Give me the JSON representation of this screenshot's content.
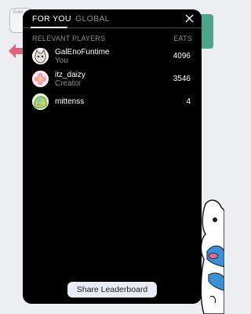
{
  "background": {
    "card_label": "Ever"
  },
  "leaderboard": {
    "tabs": [
      {
        "label": "FOR YOU",
        "active": true
      },
      {
        "label": "GLOBAL",
        "active": false
      }
    ],
    "columns": {
      "players": "RELEVANT PLAYERS",
      "score": "EATS"
    },
    "rows": [
      {
        "name": "GalEnoFuntime",
        "subtitle": "You",
        "score": "4096",
        "avatar": "cat-face-avatar"
      },
      {
        "name": "itz_daizy",
        "subtitle": "Creator",
        "score": "3546",
        "avatar": "pink-flower-avatar"
      },
      {
        "name": "mittenss",
        "subtitle": "",
        "score": "4",
        "avatar": "green-creature-avatar"
      }
    ],
    "share_label": "Share Leaderboard"
  },
  "colors": {
    "panel": "#000000",
    "muted_text": "#8f8f8f",
    "button_bg": "#e9ecf4",
    "accent_green": "#4aa58a",
    "arrow_pink": "#d9667c"
  },
  "icons": [
    "close-icon",
    "left-arrow-icon"
  ]
}
